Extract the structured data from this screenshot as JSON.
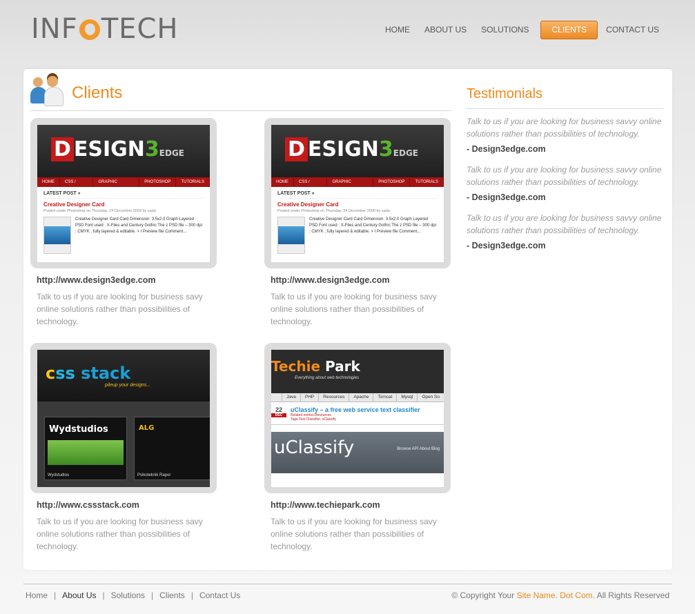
{
  "header": {
    "logo": {
      "left": "INF",
      "right": "TECH"
    },
    "nav": [
      {
        "label": "HOME",
        "active": false
      },
      {
        "label": "ABOUT US",
        "active": false
      },
      {
        "label": "SOLUTIONS",
        "active": false
      },
      {
        "label": "CLIENTS",
        "active": true
      },
      {
        "label": "CONTACT US",
        "active": false
      }
    ]
  },
  "clients": {
    "title": "Clients",
    "items": [
      {
        "url": "http://www.design3edge.com",
        "desc": "Talk to us if you are looking for business savy online solutions rather than possibilities of technology."
      },
      {
        "url": "http://www.design3edge.com",
        "desc": "Talk to us if you are looking for business savy online solutions rather than possibilities of technology."
      },
      {
        "url": "http://www.cssstack.com",
        "desc": "Talk to us if you are looking for business savy online solutions rather than possibilities of technology."
      },
      {
        "url": "http://www.techiepark.com",
        "desc": "Talk to us if you are looking for business savy online solutions rather than possibilities of technology."
      }
    ]
  },
  "thumbs": {
    "design3edge": {
      "logo_d": "D",
      "logo_esign": "ESIGN",
      "logo_3": "3",
      "logo_edge": "EDGE",
      "menu": [
        "HOME",
        "CSS / HTML",
        "GRAPHIC DESIGN",
        "PHOTOSHOP",
        "TUTORIALS"
      ],
      "latest": "LATEST POST »",
      "post_title": "Creative Designer Card",
      "post_meta": "Posted under Photoshop on Thursday, 24 December 2009 by sada",
      "post_text": "Creative Designer Card Card Dimension: 3.5x2.0 Graph Layered PSD Font used : X-Files and Century Gothic The z PSD file – 300 dpi ; CMYK ; fully layered & editable. > I Preview file Comment..."
    },
    "cssstack": {
      "logo_c": "c",
      "logo_ss": "ss",
      "logo_stack": "stack",
      "sub": "pileup your designs...",
      "box1_title": "Wydstudios",
      "box1_cap": "Wydstudios",
      "box2_title": "ALG",
      "box2_cap": "Psikoteknik Rapor"
    },
    "techiepark": {
      "logo_a": "Techie",
      "logo_b": " Park",
      "tag": "Everything about web technologies",
      "menu": [
        "Java",
        "PHP",
        "Resources",
        "Apache",
        "Tomcat",
        "Mysql",
        "Open So"
      ],
      "day": "22",
      "month": "DEC",
      "post_title": "uClassify – a free web service text classifier",
      "related": "Related entries:Resources",
      "tags": "Tags:Text Classifier, uClassify",
      "band_title": "uClassify",
      "band_menu": "Browse   API   About   Blog"
    }
  },
  "testimonials": {
    "title": "Testimonials",
    "items": [
      {
        "quote": "Talk to us if you are looking for business savvy online solutions rather than possibilities of technology.",
        "author": "- Design3edge.com"
      },
      {
        "quote": "Talk to us if you are looking for business savvy online solutions rather than possibilities of technology.",
        "author": "- Design3edge.com"
      },
      {
        "quote": "Talk to us if you are looking for business savvy online solutions rather than possibilities of technology.",
        "author": "- Design3edge.com"
      }
    ]
  },
  "footer": {
    "links": [
      "Home",
      "About Us",
      "Solutions",
      "Clients",
      "Contact Us"
    ],
    "separator": "|",
    "copyright_prefix": "© Copyright Your",
    "copyright_site": "Site Name. Dot Com.",
    "copyright_suffix": "All Rights Reserved"
  },
  "colors": {
    "accent": "#f08a1c",
    "panel": "#ffffff",
    "thumb_frame": "#dcdcdc"
  }
}
